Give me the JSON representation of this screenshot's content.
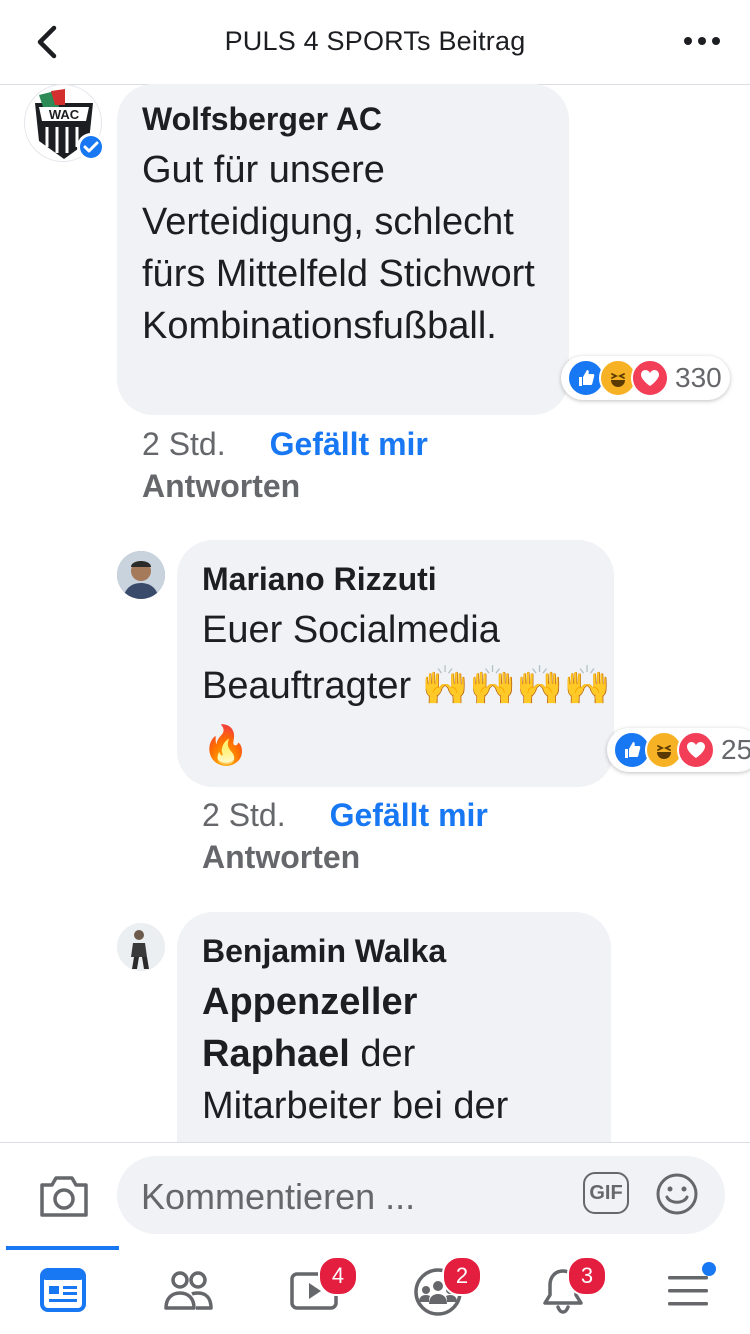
{
  "header": {
    "title": "PULS 4 SPORTs Beitrag"
  },
  "comments": [
    {
      "author": "Wolfsberger AC",
      "text": "Gut für unsere Verteidigung, schlecht fürs Mittelfeld Stichwort Kombinationsfußball.",
      "reaction_count": "330",
      "time": "2 Std.",
      "like_label": "Gefällt mir",
      "reply_label": "Antworten",
      "avatar_text": "WAC"
    },
    {
      "author": "Mariano Rizzuti",
      "text_line1": "Euer Socialmedia",
      "text_line2": "Beauftragter 🙌🙌🙌🙌",
      "text_line3": "🔥",
      "reaction_count": "25",
      "time": "2 Std.",
      "like_label": "Gefällt mir",
      "reply_label": "Antworten"
    },
    {
      "author": "Benjamin Walka",
      "bold1": "Appenzeller",
      "bold2": "Raphael",
      "text_after_bold2": " der",
      "text_line4": "Mitarbeiter bei der"
    }
  ],
  "composer": {
    "placeholder": "Kommentieren ...",
    "gif_label": "GIF"
  },
  "nav": {
    "badges": {
      "watch": "4",
      "groups": "2",
      "notifications": "3"
    }
  },
  "colors": {
    "accent": "#1877f2",
    "badge": "#e41e3f",
    "bubble": "#f0f2f5"
  }
}
